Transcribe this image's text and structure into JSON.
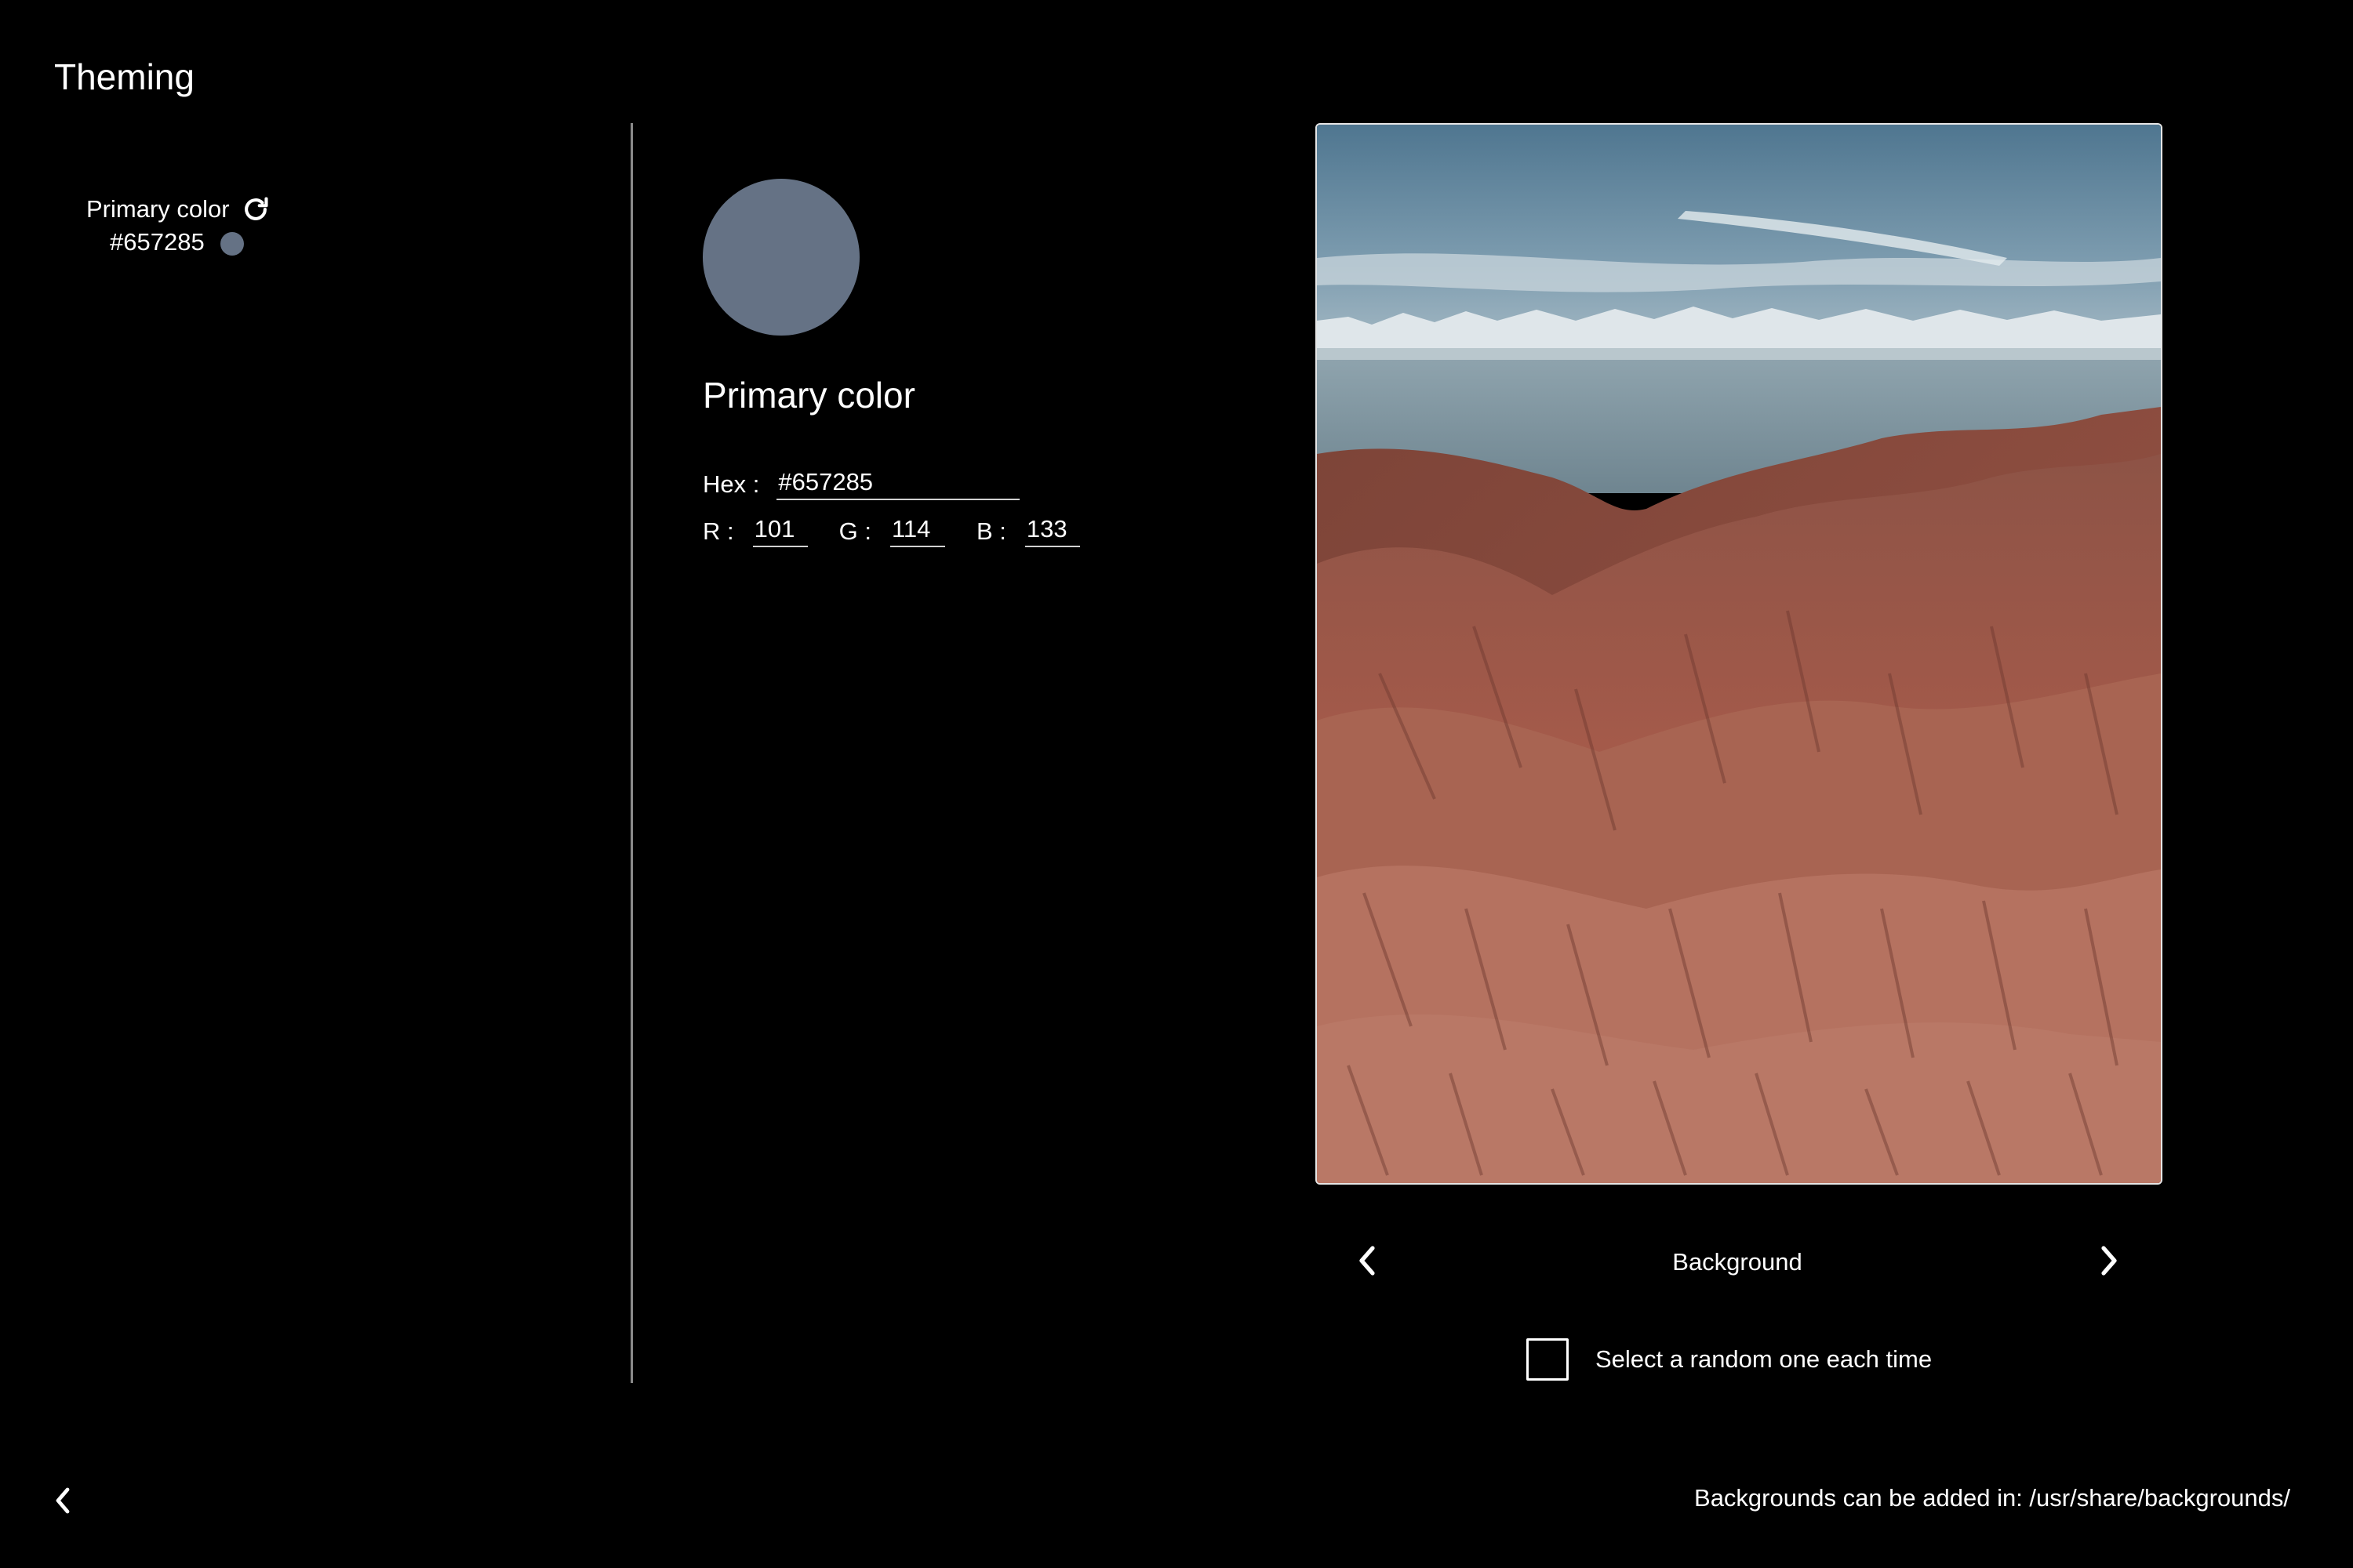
{
  "page": {
    "title": "Theming",
    "background_color": "#000000"
  },
  "sidebar": {
    "entries": [
      {
        "label": "Primary color",
        "value": "#657285",
        "color": "#657285",
        "icon": "reset-icon"
      }
    ]
  },
  "editor": {
    "title": "Primary color",
    "swatch_color": "#657285",
    "hex_label": "Hex :",
    "hex_value": "#657285",
    "r_label": "R :",
    "r_value": "101",
    "g_label": "G :",
    "g_value": "114",
    "b_label": "B :",
    "b_value": "133"
  },
  "background_picker": {
    "label": "Background",
    "prev_icon": "chevron-left-icon",
    "next_icon": "chevron-right-icon",
    "preview_description_icon": "background-preview-image",
    "random_label": "Select a random one each time",
    "random_checked": false
  },
  "footer": {
    "back_icon": "chevron-left-icon",
    "note": "Backgrounds can be added in: /usr/share/backgrounds/"
  }
}
